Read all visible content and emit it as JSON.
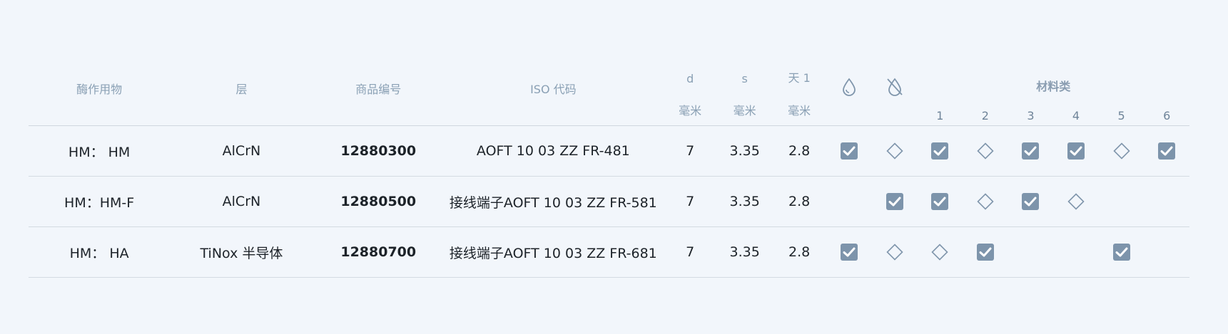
{
  "headers": {
    "enzyme": "酶作用物",
    "layer": "层",
    "item_no": "商品编号",
    "iso_code": "ISO 代码",
    "d": "d",
    "s": "s",
    "day": "天 1",
    "d_unit": "毫米",
    "s_unit": "毫米",
    "day_unit": "毫米",
    "wet_icon": "water-drop-icon",
    "dry_icon": "no-water-drop-icon",
    "material_group": "材料类",
    "material_cols": [
      "1",
      "2",
      "3",
      "4",
      "5",
      "6"
    ]
  },
  "rows": [
    {
      "enzyme": "HM： HM",
      "layer": "AlCrN",
      "item_no": "12880300",
      "iso_code": "AOFT 10 03 ZZ FR-481",
      "d": "7",
      "s": "3.35",
      "day": "2.8",
      "wet": "check",
      "dry": "diamond",
      "materials": [
        "check",
        "diamond",
        "check",
        "check",
        "diamond",
        "check"
      ]
    },
    {
      "enzyme": "HM：HM-F",
      "layer": "AlCrN",
      "item_no": "12880500",
      "iso_code": "接线端子AOFT 10 03 ZZ FR-581",
      "d": "7",
      "s": "3.35",
      "day": "2.8",
      "wet": "",
      "dry": "check",
      "materials": [
        "check",
        "diamond",
        "check",
        "diamond",
        "",
        ""
      ]
    },
    {
      "enzyme": "HM： HA",
      "layer": "TiNox 半导体",
      "item_no": "12880700",
      "iso_code": "接线端子AOFT 10 03 ZZ FR-681",
      "d": "7",
      "s": "3.35",
      "day": "2.8",
      "wet": "check",
      "dry": "diamond",
      "materials": [
        "diamond",
        "check",
        "",
        "",
        "check",
        ""
      ]
    }
  ],
  "colors": {
    "background": "#f2f6fb",
    "header_text": "#8aa0b4",
    "checkbox_fill": "#7d94ab",
    "diamond_stroke": "#8096ac",
    "body_text": "#1d2329"
  }
}
